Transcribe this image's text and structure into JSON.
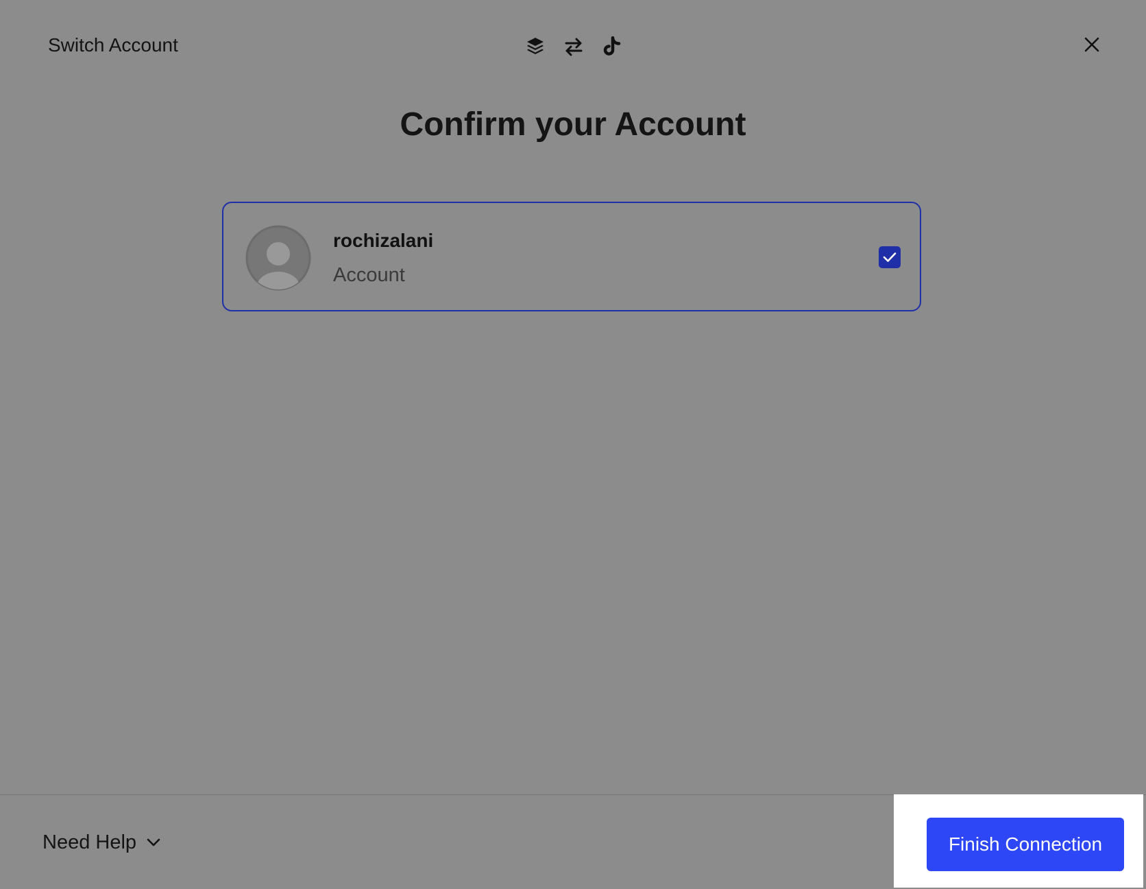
{
  "header": {
    "title": "Switch Account",
    "icons": [
      "buffer-logo-icon",
      "swap-arrows-icon",
      "tiktok-icon"
    ],
    "close_icon": "close-icon"
  },
  "main": {
    "title": "Confirm your Account",
    "account": {
      "name": "rochizalani",
      "type": "Account",
      "selected": true
    }
  },
  "footer": {
    "help_label": "Need Help",
    "finish_label": "Finish Connection"
  },
  "colors": {
    "accent": "#2d46f6",
    "selected_border": "#1f2fa8",
    "overlay_background": "#8c8c8c"
  }
}
